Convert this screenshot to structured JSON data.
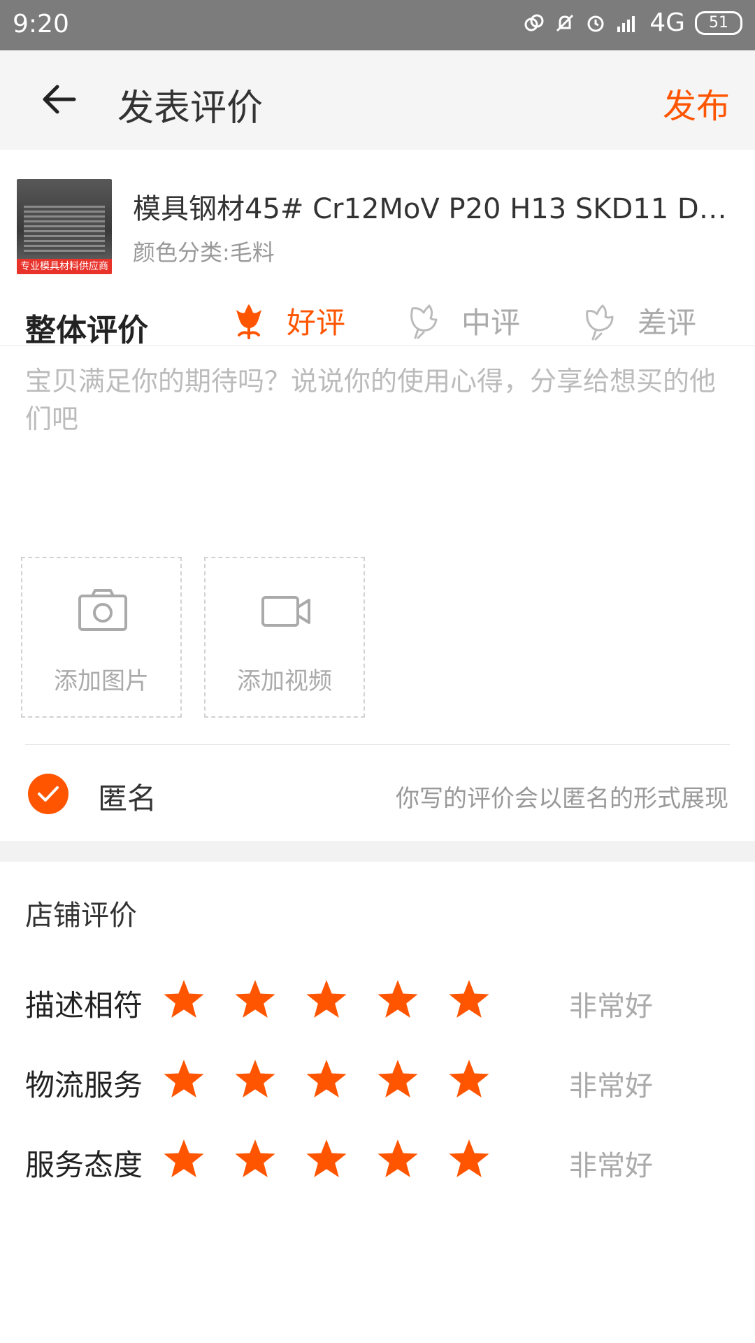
{
  "status_bar": {
    "time": "9:20",
    "network": "4G",
    "battery": "51"
  },
  "header": {
    "title": "发表评价",
    "publish_label": "发布"
  },
  "product": {
    "thumbnail_banner": "专业模具材料供应商",
    "title": "模具钢材45# Cr12MoV P20 H13 SKD11 DC...",
    "variant": "颜色分类:毛料"
  },
  "overall_rating": {
    "label": "整体评价",
    "options": [
      {
        "label": "好评",
        "selected": true
      },
      {
        "label": "中评",
        "selected": false
      },
      {
        "label": "差评",
        "selected": false
      }
    ]
  },
  "review_input": {
    "placeholder": "宝贝满足你的期待吗？说说你的使用心得，分享给想买的他们吧"
  },
  "uploads": {
    "photo_label": "添加图片",
    "video_label": "添加视频"
  },
  "anonymous": {
    "checked": true,
    "label": "匿名",
    "hint": "你写的评价会以匿名的形式展现"
  },
  "shop_rating": {
    "title": "店铺评价",
    "accent_color": "#ff5500",
    "rows": [
      {
        "label": "描述相符",
        "stars": 5,
        "value": "非常好"
      },
      {
        "label": "物流服务",
        "stars": 5,
        "value": "非常好"
      },
      {
        "label": "服务态度",
        "stars": 5,
        "value": "非常好"
      }
    ]
  }
}
